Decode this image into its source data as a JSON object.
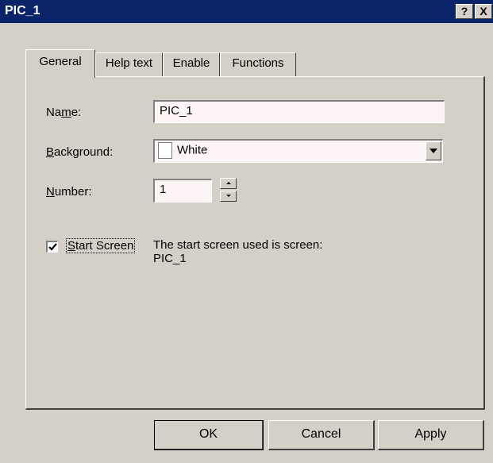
{
  "window": {
    "title": "PIC_1",
    "help_glyph": "?",
    "close_glyph": "X"
  },
  "tabs": [
    {
      "label": "General",
      "active": true
    },
    {
      "label": "Help text",
      "active": false
    },
    {
      "label": "Enable",
      "active": false
    },
    {
      "label": "Functions",
      "active": false
    }
  ],
  "general": {
    "name_label_pre": "Na",
    "name_label_key": "m",
    "name_label_post": "e:",
    "name_value": "PIC_1",
    "background_label_key": "B",
    "background_label_post": "ackground:",
    "background_value": "White",
    "number_label_key": "N",
    "number_label_post": "umber:",
    "number_value": "1",
    "start_screen_checked": true,
    "start_screen_label_key": "S",
    "start_screen_label_post": "tart Screen",
    "start_screen_info_line1": "The start screen used is screen:",
    "start_screen_info_line2": "PIC_1"
  },
  "buttons": {
    "ok": "OK",
    "cancel": "Cancel",
    "apply": "Apply"
  },
  "colors": {
    "titlebar": "#0a246a",
    "face": "#d4d0c8",
    "field_bg": "#fdf5f5"
  }
}
